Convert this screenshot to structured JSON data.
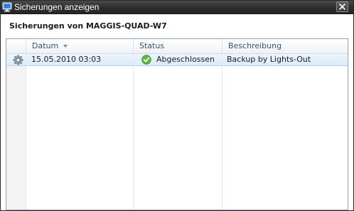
{
  "window": {
    "title": "Sicherungen anzeigen",
    "icons": {
      "app": "computer-icon",
      "close": "close-icon"
    }
  },
  "heading": "Sicherungen von MAGGIS-QUAD-W7",
  "grid": {
    "columns": [
      {
        "key": "datum",
        "label": "Datum",
        "sort": "descending"
      },
      {
        "key": "status",
        "label": "Status"
      },
      {
        "key": "beschreibung",
        "label": "Beschreibung"
      }
    ],
    "rows": [
      {
        "icon": "gear-icon",
        "datum": "15.05.2010 03:03",
        "status_icon": "checkmark-icon",
        "status": "Abgeschlossen",
        "beschreibung": "Backup by Lights-Out",
        "selected": true
      }
    ]
  },
  "colors": {
    "titlebar": "#2d2d2d",
    "header_text": "#3b5169",
    "selection": "#dcebfb",
    "status_ok": "#4caf35"
  }
}
